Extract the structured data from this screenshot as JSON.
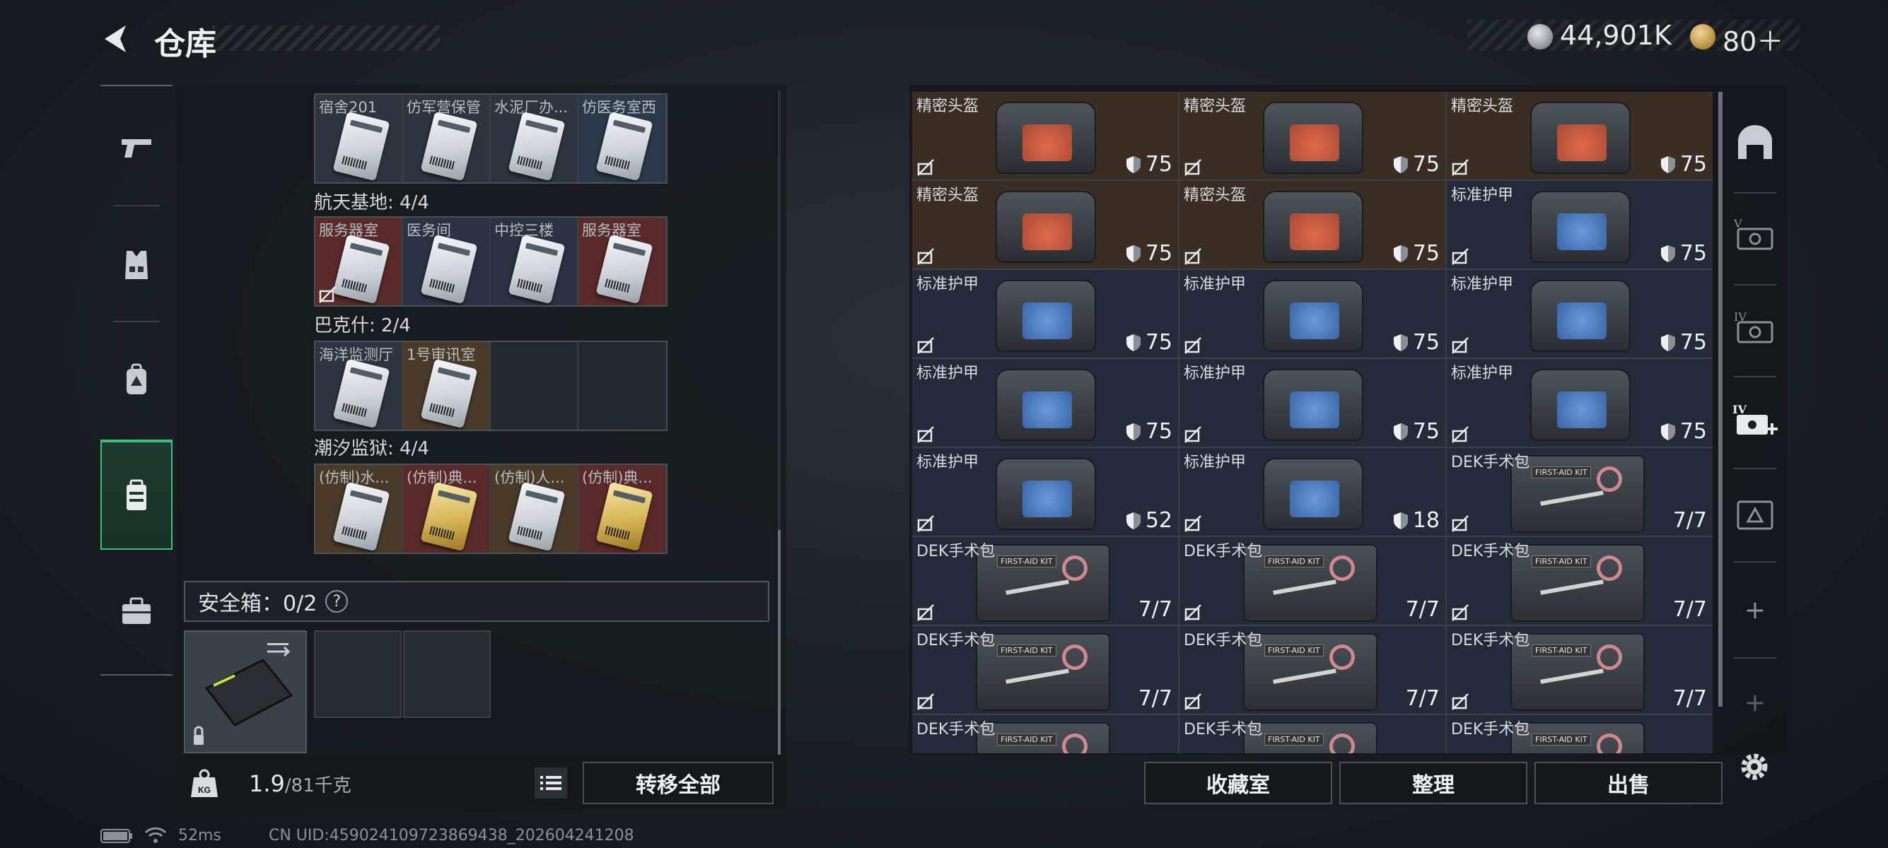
{
  "header": {
    "title": "仓库",
    "silver": "44,901K",
    "gold": "80＋"
  },
  "left_nav": {
    "items": [
      {
        "icon": "gun-icon"
      },
      {
        "icon": "vest-icon"
      },
      {
        "icon": "backpack-icon"
      },
      {
        "icon": "keycard-case-icon",
        "active": true
      },
      {
        "icon": "toolbox-icon"
      }
    ]
  },
  "key_sections": {
    "top_row": [
      "宿舍201",
      "仿军营保管",
      "水泥厂办...",
      "仿医务室西"
    ],
    "hangtian": {
      "label": "航天基地: 4/4",
      "cards": [
        "服务器室",
        "医务间",
        "中控三楼",
        "服务器室"
      ]
    },
    "bakeshi": {
      "label": "巴克什: 2/4",
      "cards": [
        "海洋监测厅",
        "1号审讯室"
      ]
    },
    "chaoxi": {
      "label": "潮汐监狱: 4/4",
      "cards": [
        "(仿制)水...",
        "(仿制)典...",
        "(仿制)人...",
        "(仿制)典..."
      ]
    }
  },
  "safe_box": {
    "label": "安全箱：0/2",
    "help": "?"
  },
  "weight": {
    "current": "1.9",
    "max": "/81千克",
    "kg_icon": "KG"
  },
  "buttons": {
    "transfer_all": "转移全部",
    "collection": "收藏室",
    "organize": "整理",
    "sell": "出售"
  },
  "status": {
    "ping": "52ms",
    "uid": "CN UID:459024109723869438_202604241208"
  },
  "inventory": {
    "items": [
      {
        "name": "精密头盔",
        "value": "75",
        "kind": "helmet"
      },
      {
        "name": "精密头盔",
        "value": "75",
        "kind": "helmet"
      },
      {
        "name": "精密头盔",
        "value": "75",
        "kind": "helmet"
      },
      {
        "name": "精密头盔",
        "value": "75",
        "kind": "helmet"
      },
      {
        "name": "精密头盔",
        "value": "75",
        "kind": "helmet"
      },
      {
        "name": "标准护甲",
        "value": "75",
        "kind": "armor"
      },
      {
        "name": "标准护甲",
        "value": "75",
        "kind": "armor"
      },
      {
        "name": "标准护甲",
        "value": "75",
        "kind": "armor"
      },
      {
        "name": "标准护甲",
        "value": "75",
        "kind": "armor"
      },
      {
        "name": "标准护甲",
        "value": "75",
        "kind": "armor"
      },
      {
        "name": "标准护甲",
        "value": "75",
        "kind": "armor"
      },
      {
        "name": "标准护甲",
        "value": "75",
        "kind": "armor"
      },
      {
        "name": "标准护甲",
        "value": "52",
        "kind": "armor"
      },
      {
        "name": "标准护甲",
        "value": "18",
        "kind": "armor"
      },
      {
        "name": "DEK手术包",
        "value": "7/7",
        "kind": "kit"
      },
      {
        "name": "DEK手术包",
        "value": "7/7",
        "kind": "kit"
      },
      {
        "name": "DEK手术包",
        "value": "7/7",
        "kind": "kit"
      },
      {
        "name": "DEK手术包",
        "value": "7/7",
        "kind": "kit"
      },
      {
        "name": "DEK手术包",
        "value": "7/7",
        "kind": "kit"
      },
      {
        "name": "DEK手术包",
        "value": "7/7",
        "kind": "kit"
      },
      {
        "name": "DEK手术包",
        "value": "7/7",
        "kind": "kit"
      },
      {
        "name": "DEK手术包",
        "value": "",
        "kind": "kit"
      },
      {
        "name": "DEK手术包",
        "value": "",
        "kind": "kit"
      },
      {
        "name": "DEK手术包",
        "value": "",
        "kind": "kit"
      }
    ],
    "kit_tag": "FIRST-AID KIT"
  },
  "right_tabs": [
    "helmet-slot-icon",
    "case-v-icon",
    "case-iv-icon",
    "case-iv-plus-icon",
    "case-lock-icon",
    "plus-icon",
    "plus-icon"
  ],
  "plus_label": "+"
}
